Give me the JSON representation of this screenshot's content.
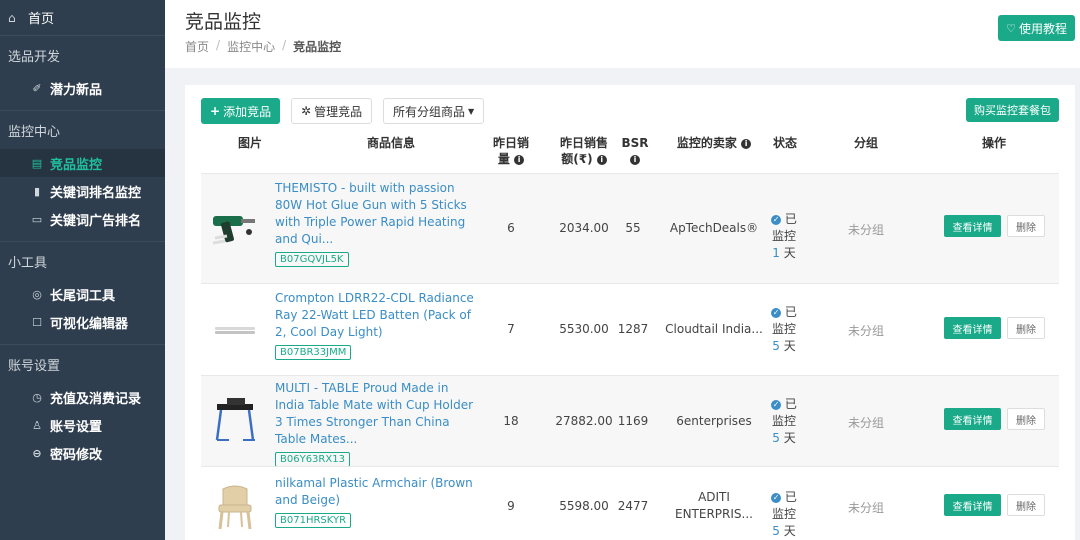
{
  "sidebar": {
    "home": "首页",
    "sections": [
      {
        "title": "选品开发",
        "items": [
          {
            "label": "潜力新品",
            "icon": "tag-icon"
          }
        ]
      },
      {
        "title": "监控中心",
        "items": [
          {
            "label": "竞品监控",
            "icon": "monitor-icon",
            "active": true
          },
          {
            "label": "关键词排名监控",
            "icon": "bar-chart-icon"
          },
          {
            "label": "关键词广告排名",
            "icon": "ad-icon"
          }
        ]
      },
      {
        "title": "小工具",
        "items": [
          {
            "label": "长尾词工具",
            "icon": "target-icon"
          },
          {
            "label": "可视化编辑器",
            "icon": "edit-icon"
          }
        ]
      },
      {
        "title": "账号设置",
        "items": [
          {
            "label": "充值及消费记录",
            "icon": "recharge-icon"
          },
          {
            "label": "账号设置",
            "icon": "user-icon"
          },
          {
            "label": "密码修改",
            "icon": "lock-icon"
          }
        ]
      }
    ]
  },
  "header": {
    "title": "竞品监控",
    "breadcrumb": [
      "首页",
      "监控中心",
      "竞品监控"
    ],
    "tutorial": "使用教程"
  },
  "toolbar": {
    "add": "添加竞品",
    "manage": "管理竞品",
    "group_select": "所有分组商品",
    "buy": "购买监控套餐包"
  },
  "table": {
    "headers": {
      "image": "图片",
      "info": "商品信息",
      "sales_l1": "昨日销",
      "sales_l2": "量",
      "revenue_l1": "昨日销售",
      "revenue_l2": "额(₹)",
      "bsr": "BSR",
      "seller": "监控的卖家",
      "status": "状态",
      "group": "分组",
      "action": "操作"
    },
    "rows": [
      {
        "title": "THEMISTO - built with passion 80W Hot Glue Gun with 5 Sticks with Triple Power Rapid Heating and Qui...",
        "asin": "B07GQVJL5K",
        "sales": "6",
        "revenue": "2034.00",
        "bsr": "55",
        "seller": "ApTechDeals®",
        "status_l1": "已",
        "status_l2": "监控",
        "days": "1",
        "days_unit": "天",
        "group": "未分组",
        "detail": "查看详情",
        "delete": "删除"
      },
      {
        "title": "Crompton LDRR22-CDL Radiance Ray 22-Watt LED Batten (Pack of 2, Cool Day Light)",
        "asin": "B07BR33JMM",
        "sales": "7",
        "revenue": "5530.00",
        "bsr": "1287",
        "seller": "Cloudtail India...",
        "status_l1": "已",
        "status_l2": "监控",
        "days": "5",
        "days_unit": "天",
        "group": "未分组",
        "detail": "查看详情",
        "delete": "删除"
      },
      {
        "title": "MULTI - TABLE Proud Made in India Table Mate with Cup Holder 3 Times Stronger Than China Table Mates...",
        "asin": "B06Y63RX13",
        "sales": "18",
        "revenue": "27882.00",
        "bsr": "1169",
        "seller": "6enterprises",
        "status_l1": "已",
        "status_l2": "监控",
        "days": "5",
        "days_unit": "天",
        "group": "未分组",
        "detail": "查看详情",
        "delete": "删除"
      },
      {
        "title": "nilkamal Plastic Armchair (Brown and Beige)",
        "asin": "B071HRSKYR",
        "sales": "9",
        "revenue": "5598.00",
        "bsr": "2477",
        "seller_l1": "ADITI",
        "seller_l2": "ENTERPRIS...",
        "status_l1": "已",
        "status_l2": "监控",
        "days": "5",
        "days_unit": "天",
        "group": "未分组",
        "detail": "查看详情",
        "delete": "删除"
      }
    ]
  }
}
